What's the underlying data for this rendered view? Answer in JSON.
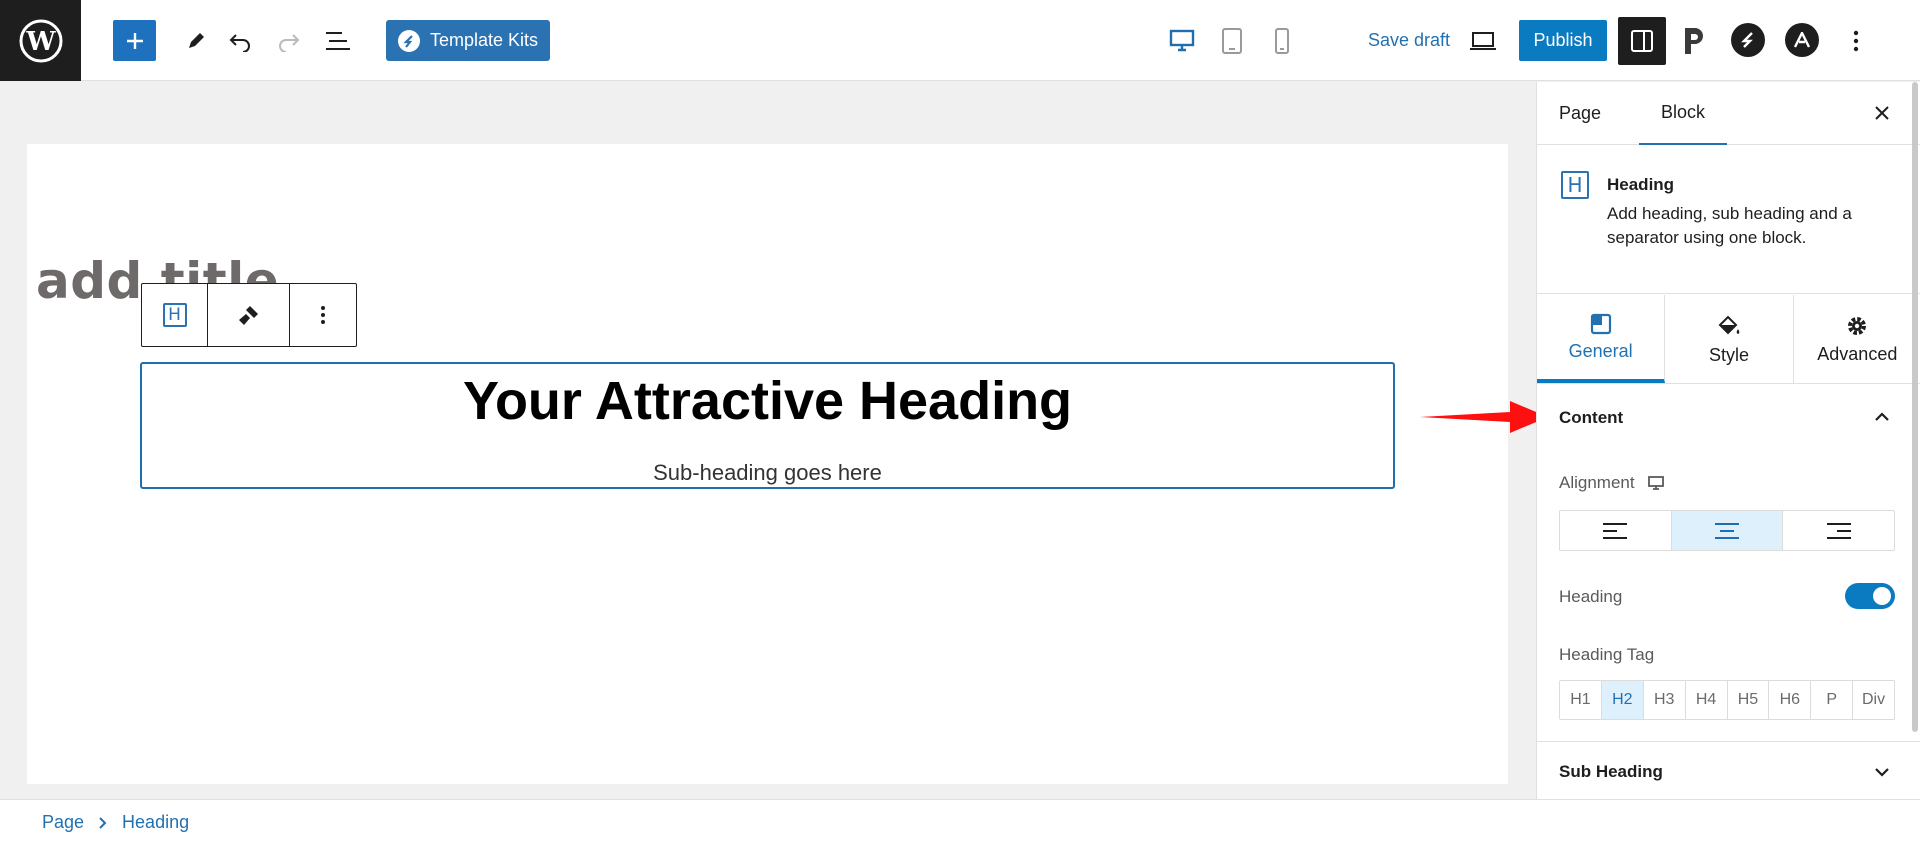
{
  "topbar": {
    "template_kits_label": "Template Kits",
    "save_draft_label": "Save draft",
    "publish_label": "Publish"
  },
  "canvas": {
    "post_title": "add title",
    "heading_text": "Your Attractive Heading",
    "subheading_text": "Sub-heading goes here"
  },
  "sidebar": {
    "tabs": [
      {
        "label": "Page",
        "active": false
      },
      {
        "label": "Block",
        "active": true
      }
    ],
    "block": {
      "icon_letter": "H",
      "title": "Heading",
      "description": "Add heading, sub heading and a separator using one block."
    },
    "panel_tabs": [
      {
        "label": "General",
        "icon": "general-icon",
        "active": true
      },
      {
        "label": "Style",
        "icon": "paint-bucket-icon",
        "active": false
      },
      {
        "label": "Advanced",
        "icon": "gear-icon",
        "active": false
      }
    ],
    "content_section": {
      "title": "Content",
      "alignment_label": "Alignment",
      "alignment_selected": "center",
      "heading_label": "Heading",
      "heading_enabled": true,
      "heading_tag_label": "Heading Tag",
      "heading_tags": [
        "H1",
        "H2",
        "H3",
        "H4",
        "H5",
        "H6",
        "P",
        "Div"
      ],
      "heading_tag_selected": "H2"
    },
    "subheading_section": {
      "title": "Sub Heading"
    }
  },
  "breadcrumb": {
    "items": [
      "Page",
      "Heading"
    ]
  },
  "colors": {
    "accent": "#0a7bc1",
    "template_kits": "#2b72b3",
    "arrow": "#ff0000"
  }
}
